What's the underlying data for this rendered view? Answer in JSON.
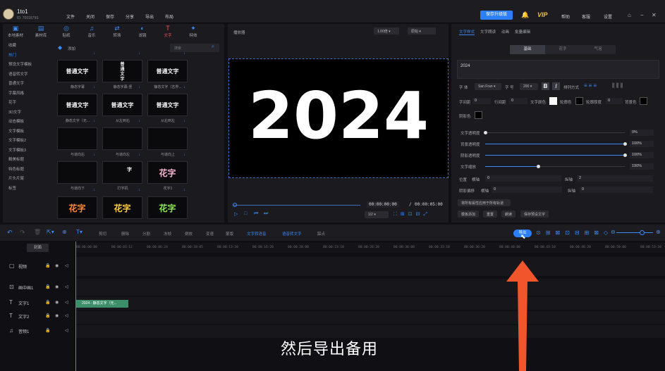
{
  "app": {
    "user_name": "1to1",
    "user_id": "ID: 7001879S"
  },
  "menu": [
    "文件",
    "关闭",
    "保存",
    "分享",
    "导出",
    "布局"
  ],
  "header_right": {
    "vip_button": "保存升级版",
    "vip": "VIP",
    "help": "帮助",
    "feedback": "客服",
    "settings": "设置"
  },
  "resource_tabs": [
    {
      "label": "本地素材",
      "icon": "▣"
    },
    {
      "label": "素材库",
      "icon": "▤"
    },
    {
      "label": "贴纸",
      "icon": "◎"
    },
    {
      "label": "音乐",
      "icon": "♫"
    },
    {
      "label": "转场",
      "icon": "⇄"
    },
    {
      "label": "滤镜",
      "icon": "◐"
    },
    {
      "label": "文字",
      "icon": "T"
    },
    {
      "label": "特效",
      "icon": "✦"
    }
  ],
  "categories": [
    "收藏",
    "热门",
    "预设文字模板",
    "语音转文字",
    "普通文字",
    "字幕风格",
    "花字",
    "3D文字",
    "动态模板",
    "文字模板",
    "文字模板2",
    "文字模板3",
    "精美标题",
    "特色标题",
    "片头片尾",
    "标签"
  ],
  "panel_header": {
    "title": "添加",
    "search_placeholder": "搜索"
  },
  "text_tiles": [
    {
      "preview": "普通文字",
      "label": "静态字幕"
    },
    {
      "preview": "普\n通\n文\n字",
      "label": "静态字幕-竖"
    },
    {
      "preview": "普通文字",
      "label": "静态文字（志界..."
    },
    {
      "preview": "普通文字",
      "label": "静态文字（无..."
    },
    {
      "preview": "普通文字",
      "label": "从左到右"
    },
    {
      "preview": "普通文字",
      "label": "从右到左"
    },
    {
      "preview": "",
      "label": "与道向右"
    },
    {
      "preview": "",
      "label": "与道向左"
    },
    {
      "preview": "",
      "label": "与道向上"
    },
    {
      "preview": "",
      "label": "与道向下"
    },
    {
      "preview": "字",
      "label": "打字机"
    },
    {
      "preview": "花字",
      "label": "花字1"
    },
    {
      "preview": "花字",
      "label": ""
    },
    {
      "preview": "花字",
      "label": ""
    },
    {
      "preview": "花字",
      "label": ""
    }
  ],
  "player": {
    "title": "播放器",
    "ratio": "1.00倍",
    "mode": "原始",
    "main_text": "2024",
    "current_time": "00:00:00:00",
    "total_time": "00:00:05:00",
    "scale": "1/2"
  },
  "props": {
    "tabs": [
      "文字样式",
      "文字朗读",
      "动画",
      "批量编辑"
    ],
    "segments": [
      "基础",
      "花字",
      "气泡"
    ],
    "text_value": "2024",
    "font_label": "字 体",
    "font_value": "San Fran",
    "size_label": "字 号",
    "size_value": "200",
    "arrange_label": "排列方式",
    "char_spacing_label": "字间距",
    "char_spacing_value": "0",
    "line_spacing_label": "行间距",
    "line_spacing_value": "0",
    "text_color_label": "文字颜色",
    "outline_label": "轮廓色",
    "outline_width_label": "轮廓厚度",
    "outline_width_value": "0",
    "bg_label": "背景色",
    "shadow_label": "阴影色",
    "sliders": [
      {
        "label": "文字透明度",
        "value": "0%",
        "fill": 0.0
      },
      {
        "label": "背景透明度",
        "value": "100%",
        "fill": 1.0
      },
      {
        "label": "阴影透明度",
        "value": "100%",
        "fill": 1.0
      },
      {
        "label": "文字缩放",
        "value": "190%",
        "fill": 0.38
      }
    ],
    "pos_label": "位置",
    "pos_x_label": "横轴",
    "pos_x": "0",
    "pos_y_label": "纵轴",
    "pos_y": "2",
    "shadow_offset_label": "阴影偏移",
    "shadow_x_label": "横轴",
    "shadow_x": "0",
    "shadow_y_label": "纵轴",
    "shadow_y": "0",
    "apply_all": "将所有属性应用于所有轨道",
    "buttons": [
      "模板添加",
      "重置",
      "朗读",
      "保存预设文字"
    ]
  },
  "toolbar": {
    "tools": [
      "剪切",
      "删除",
      "分割",
      "冻帧",
      "倒放",
      "变速",
      "蒙版",
      "文字转语音",
      "语音转文字",
      "踩点"
    ],
    "export": "导出"
  },
  "timeline": {
    "cover_button": "封面",
    "ruler": [
      "00:00:00:00",
      "00:00:03:12",
      "00:00:06:24",
      "00:00:10:05",
      "00:00:13:10",
      "00:00:16:20",
      "00:00:20:00",
      "00:00:23:10",
      "00:00:26:20",
      "00:00:30:00",
      "00:00:33:10",
      "00:00:36:20",
      "00:00:40:00",
      "00:00:43:10",
      "00:00:46:20",
      "00:00:50:00",
      "00:00:53:10"
    ],
    "tracks": [
      {
        "name": "视频",
        "icon": "▢"
      },
      {
        "name": "画中画1",
        "icon": "⊡"
      },
      {
        "name": "文字1",
        "icon": "T"
      },
      {
        "name": "文字2",
        "icon": "T"
      },
      {
        "name": "音频1",
        "icon": "♫"
      }
    ],
    "clip_label": "2024 - 静态文字（无..."
  },
  "caption": "然后导出备用",
  "colors": {
    "accent": "#2d7ff9",
    "active_tab": "#f25353",
    "clip": "#3d8f6a",
    "arrow": "#f0552b"
  }
}
